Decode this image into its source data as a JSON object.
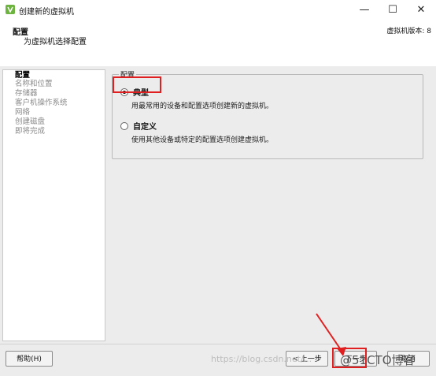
{
  "window": {
    "title": "创建新的虚拟机",
    "minimize": "—",
    "maximize": "☐",
    "close": "✕"
  },
  "header": {
    "title": "配置",
    "subtitle": "为虚拟机选择配置",
    "version": "虚拟机版本: 8"
  },
  "steps": [
    {
      "label": "配置",
      "active": true
    },
    {
      "label": "名称和位置",
      "active": false
    },
    {
      "label": "存储器",
      "active": false
    },
    {
      "label": "客户机操作系统",
      "active": false
    },
    {
      "label": "网络",
      "active": false
    },
    {
      "label": "创建磁盘",
      "active": false
    },
    {
      "label": "即将完成",
      "active": false
    }
  ],
  "config": {
    "legend": "配置",
    "options": [
      {
        "label": "典型",
        "desc": "用最常用的设备和配置选项创建新的虚拟机。",
        "checked": true
      },
      {
        "label": "自定义",
        "desc": "使用其他设备或特定的配置选项创建虚拟机。",
        "checked": false
      }
    ]
  },
  "footer": {
    "help": "帮助(H)",
    "back": "< 上一步",
    "next": "下一步",
    "cancel": "取消"
  },
  "watermark": {
    "url": "https://blog.csdn.net/...",
    "logo": "@51CTO博客"
  },
  "colors": {
    "highlight": "#e02020",
    "brand_icon": "#6db33f"
  }
}
